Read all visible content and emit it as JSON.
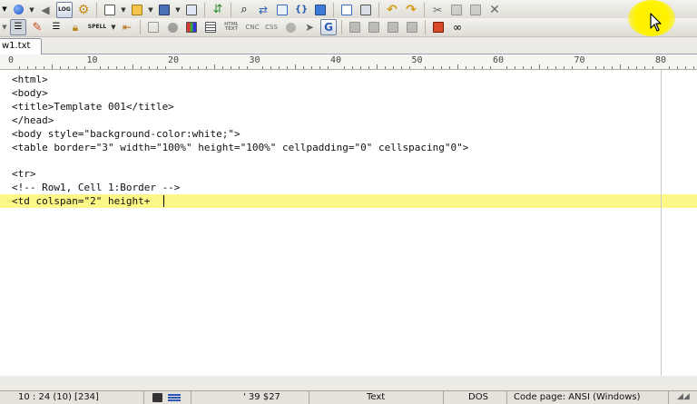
{
  "tabs": [
    {
      "label": "w1.txt"
    }
  ],
  "ruler": {
    "labels": [
      "0",
      "10",
      "20",
      "30",
      "40",
      "50",
      "60",
      "70",
      "80"
    ]
  },
  "toolbar": {
    "spell_label": "SPELL",
    "log_label": "LOG",
    "html_label": "HTML TEXT"
  },
  "editor": {
    "lines": [
      "<html>",
      "<body>",
      "<title>Template 001</title>",
      "</head>",
      "<body style=\"background-color:white;\">",
      "<table border=\"3\" width=\"100%\" height=\"100%\" cellpadding=\"0\" cellspacing\"0\">",
      "",
      "<tr>",
      "<!-- Row1, Cell 1:Border -->",
      "<td colspan=\"2\" height+"
    ],
    "current_line_index": 9,
    "highlight_color": "#fdf788"
  },
  "statusbar": {
    "position": "10 : 24  (10)  [234]",
    "offset": "'  39  $27",
    "mode": "Text",
    "line_endings": "DOS",
    "code_page": "Code page: ANSI (Windows)"
  },
  "colors": {
    "cursor_highlight": "#fff200"
  }
}
